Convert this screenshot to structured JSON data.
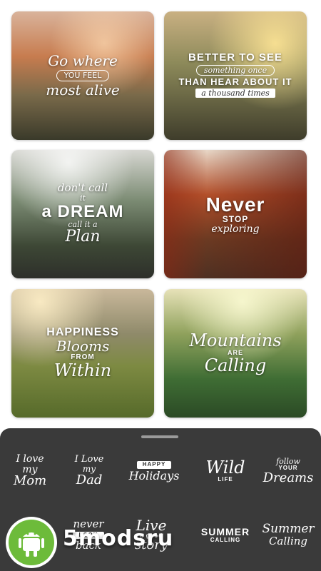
{
  "cards": [
    {
      "lines": [
        "Go where",
        "YOU FEEL",
        "most alive"
      ]
    },
    {
      "lines": [
        "BETTER TO SEE",
        "something once",
        "THAN HEAR ABOUT IT",
        "a thousand times"
      ]
    },
    {
      "lines": [
        "don't call",
        "it",
        "a DREAM",
        "call it a",
        "Plan"
      ]
    },
    {
      "lines": [
        "Never",
        "STOP",
        "exploring"
      ]
    },
    {
      "lines": [
        "HAPPINESS",
        "Blooms",
        "FROM",
        "Within"
      ]
    },
    {
      "lines": [
        "Mountains",
        "ARE",
        "Calling"
      ]
    }
  ],
  "stickers": [
    {
      "lines": [
        "I love",
        "my",
        "Mom"
      ]
    },
    {
      "lines": [
        "I Love",
        "my",
        "Dad"
      ]
    },
    {
      "lines": [
        "HAPPY",
        "Holidays"
      ]
    },
    {
      "lines": [
        "Wild",
        "LIFE"
      ]
    },
    {
      "lines": [
        "follow",
        "YOUR",
        "Dreams"
      ]
    },
    {
      "lines": [
        "never",
        "LOOK",
        "back"
      ]
    },
    {
      "lines": [
        "Live",
        "a good",
        "story"
      ]
    },
    {
      "lines": [
        "SUMMER",
        "CALLING"
      ]
    },
    {
      "lines": [
        "Summer",
        "Calling"
      ]
    }
  ],
  "watermark": "5modsru",
  "colors": {
    "sheet": "#3a3a3a",
    "android": "#6dbb3a"
  },
  "icons": {
    "android": "android-icon"
  }
}
